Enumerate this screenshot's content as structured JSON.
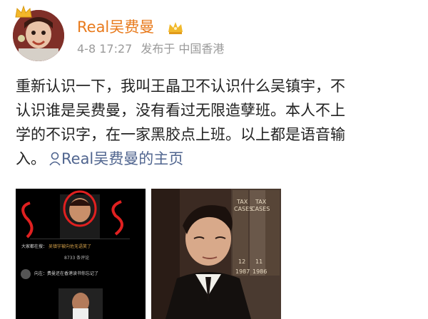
{
  "user": {
    "name": "Real吴费曼",
    "date": "4-8 17:27",
    "posted_from": "发布于 中国香港"
  },
  "post": {
    "lines": [
      "重新认识一下，我叫王晶卫不认识什么吴镇宇，不",
      "认识谁是吴费曼，没有看过无限造孽班。本人不上",
      "学的不识字，在一家黑胶点上班。以上都是语音输"
    ],
    "last_line_prefix": "入。",
    "profile_link_text": "Real吴费曼的主页"
  },
  "images": {
    "left": {
      "viewers_label": "大家都在搜：",
      "search_text": "吴镇宇被向佐无语笑了",
      "comments_count": "8733 条评论",
      "comment_text": "向左：费曼还在香港读书你忘记了"
    },
    "right": {
      "book_labels": [
        "TAX",
        "CASES",
        "TAX",
        "CASES",
        "12",
        "11",
        "1987",
        "1986"
      ]
    }
  },
  "colors": {
    "username": "#e87a1c",
    "link": "#50658f",
    "meta": "#9a9a9a",
    "text": "#222222"
  },
  "icons": {
    "crown": "crown-icon",
    "vip": "vip-crown-icon",
    "link": "user-profile-icon"
  }
}
